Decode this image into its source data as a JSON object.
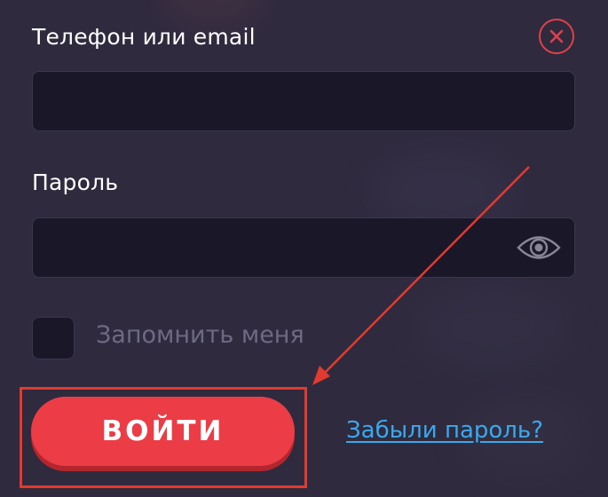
{
  "form": {
    "login_label": "Телефон или email",
    "login_value": "",
    "password_label": "Пароль",
    "password_value": "",
    "remember_label": "Запомнить меня",
    "remember_checked": false,
    "submit_label": "ВОЙТИ",
    "forgot_link": "Забыли пароль?"
  },
  "icons": {
    "close": "close-icon",
    "show_password": "eye-icon"
  },
  "colors": {
    "background": "#2f2a3e",
    "field_background": "#1a1828",
    "accent_red": "#ec3d47",
    "link_blue": "#3aa8ea",
    "annotation_red": "#e23a2f"
  }
}
